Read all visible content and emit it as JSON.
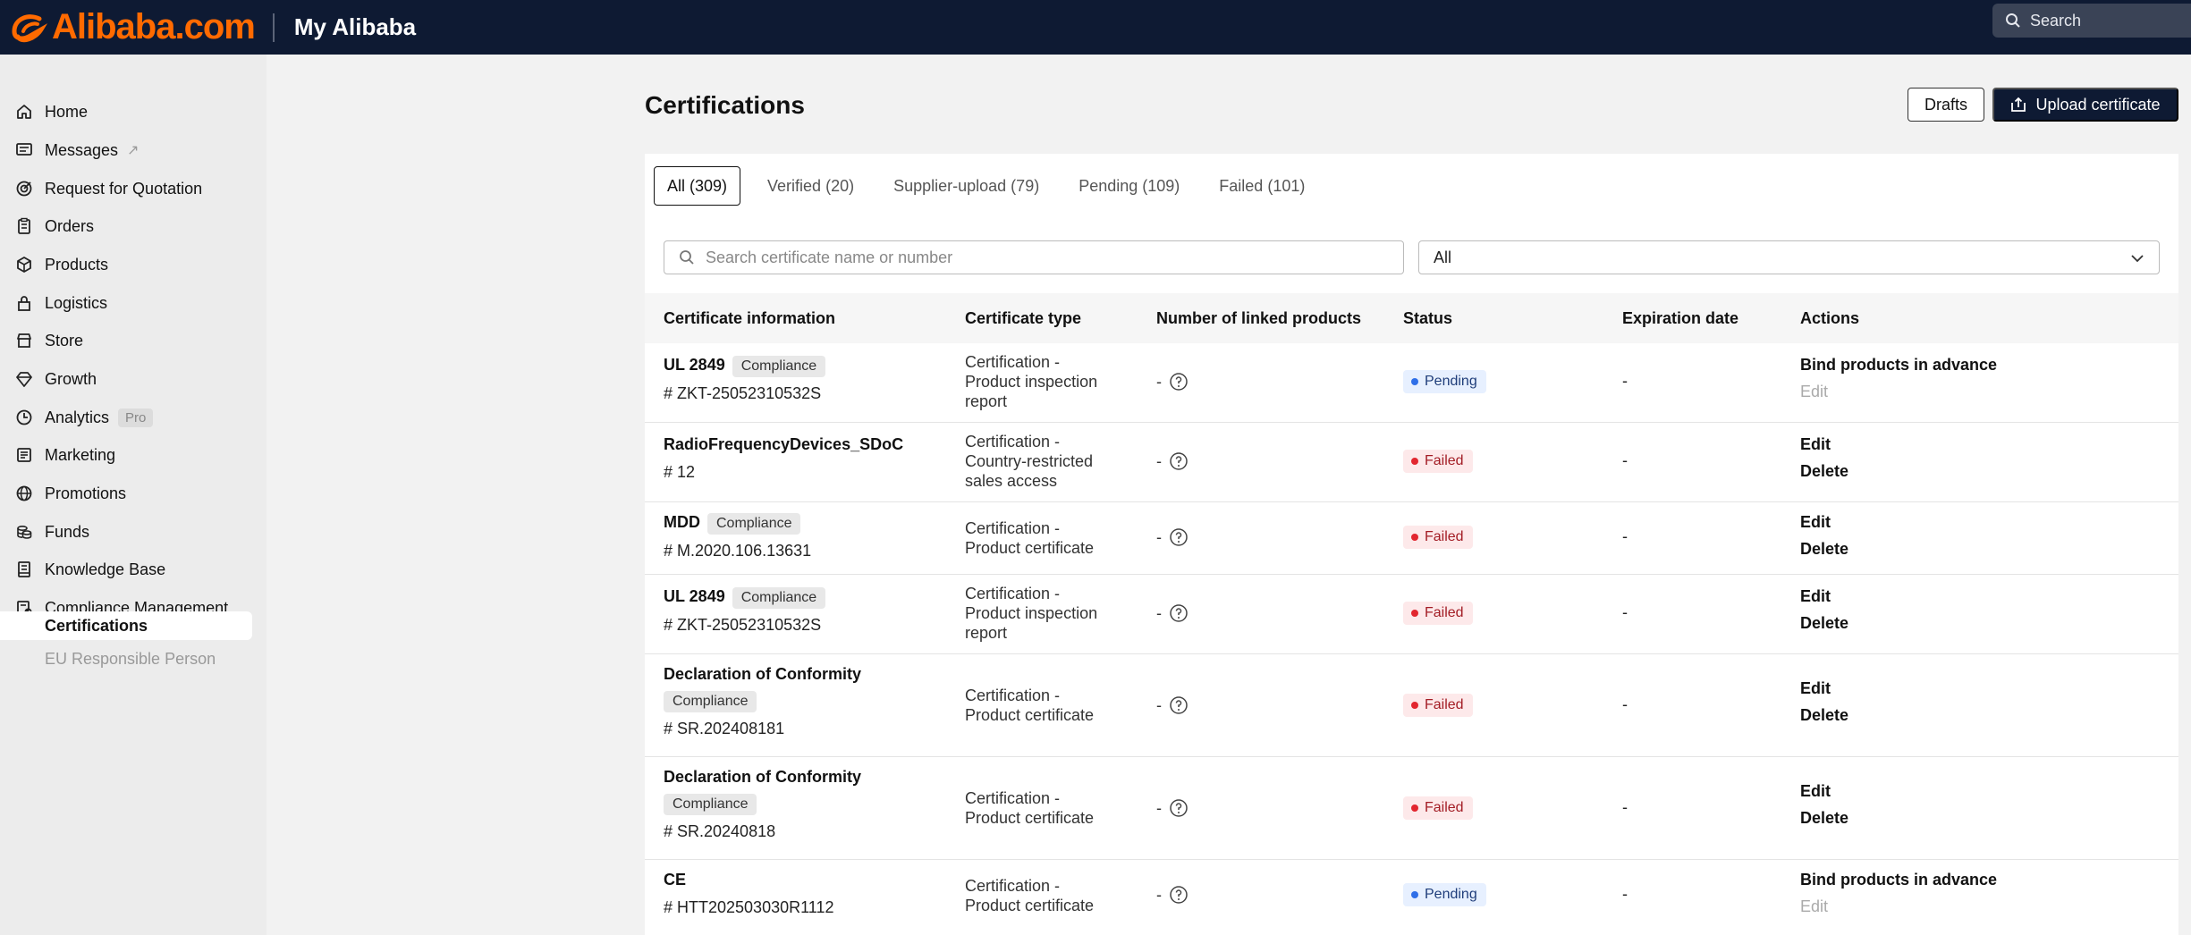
{
  "header": {
    "logo_text": "Alibaba.com",
    "title": "My Alibaba",
    "search_placeholder": "Search"
  },
  "sidebar": {
    "items": [
      {
        "label": "Home",
        "icon": "home-icon"
      },
      {
        "label": "Messages",
        "icon": "messages-icon",
        "ext": "↗"
      },
      {
        "label": "Request for Quotation",
        "icon": "rfq-icon"
      },
      {
        "label": "Orders",
        "icon": "orders-icon"
      },
      {
        "label": "Products",
        "icon": "products-icon"
      },
      {
        "label": "Logistics",
        "icon": "logistics-icon"
      },
      {
        "label": "Store",
        "icon": "store-icon"
      },
      {
        "label": "Growth",
        "icon": "growth-icon"
      },
      {
        "label": "Analytics",
        "icon": "analytics-icon",
        "badge": "Pro"
      },
      {
        "label": "Marketing",
        "icon": "marketing-icon"
      },
      {
        "label": "Promotions",
        "icon": "promotions-icon"
      },
      {
        "label": "Funds",
        "icon": "funds-icon"
      },
      {
        "label": "Knowledge Base",
        "icon": "knowledge-icon"
      },
      {
        "label": "Compliance Management",
        "icon": "compliance-icon"
      }
    ],
    "sub_items": [
      {
        "label": "Certifications",
        "active": true
      },
      {
        "label": "EU Responsible Person",
        "active": false
      }
    ]
  },
  "main": {
    "title": "Certifications",
    "drafts_label": "Drafts",
    "upload_label": "Upload certificate",
    "tabs": [
      "All (309)",
      "Verified (20)",
      "Supplier-upload (79)",
      "Pending (109)",
      "Failed (101)"
    ],
    "search_placeholder": "Search certificate name or number",
    "filter_value": "All",
    "columns": [
      "Certificate information",
      "Certificate type",
      "Number of linked products",
      "Status",
      "Expiration date",
      "Actions"
    ],
    "rows": [
      {
        "name": "UL 2849",
        "badge": "Compliance",
        "number": "# ZKT-25052310532S",
        "type": [
          "Certification -",
          "Product inspection",
          "report"
        ],
        "linked": "-",
        "status": "Pending",
        "expiration": "-",
        "actions": [
          "Bind products in advance",
          "Edit"
        ]
      },
      {
        "name": "RadioFrequencyDevices_SDoC",
        "badge": "",
        "number": "# 12",
        "type": [
          "Certification -",
          "Country-restricted",
          "sales access"
        ],
        "linked": "-",
        "status": "Failed",
        "expiration": "-",
        "actions": [
          "Edit",
          "Delete"
        ]
      },
      {
        "name": "MDD",
        "badge": "Compliance",
        "number": "# M.2020.106.13631",
        "type": [
          "Certification -",
          "Product certificate"
        ],
        "linked": "-",
        "status": "Failed",
        "expiration": "-",
        "actions": [
          "Edit",
          "Delete"
        ]
      },
      {
        "name": "UL 2849",
        "badge": "Compliance",
        "number": "# ZKT-25052310532S",
        "type": [
          "Certification -",
          "Product inspection",
          "report"
        ],
        "linked": "-",
        "status": "Failed",
        "expiration": "-",
        "actions": [
          "Edit",
          "Delete"
        ]
      },
      {
        "name": "Declaration of Conformity",
        "badge": "Compliance",
        "number": "# SR.202408181",
        "type": [
          "Certification -",
          "Product certificate"
        ],
        "linked": "-",
        "status": "Failed",
        "expiration": "-",
        "actions": [
          "Edit",
          "Delete"
        ]
      },
      {
        "name": "Declaration of Conformity",
        "badge": "Compliance",
        "number": "# SR.20240818",
        "type": [
          "Certification -",
          "Product certificate"
        ],
        "linked": "-",
        "status": "Failed",
        "expiration": "-",
        "actions": [
          "Edit",
          "Delete"
        ]
      },
      {
        "name": "CE",
        "badge": "",
        "number": "# HTT202503030R1112",
        "type": [
          "Certification -",
          "Product certificate"
        ],
        "linked": "-",
        "status": "Pending",
        "expiration": "-",
        "actions": [
          "Bind products in advance",
          "Edit"
        ]
      }
    ]
  },
  "colors": {
    "topbar": "#0e1a33",
    "brand_orange": "#ff6a00",
    "pending_blue": "#2f6fe8",
    "failed_red": "#e2262f"
  }
}
